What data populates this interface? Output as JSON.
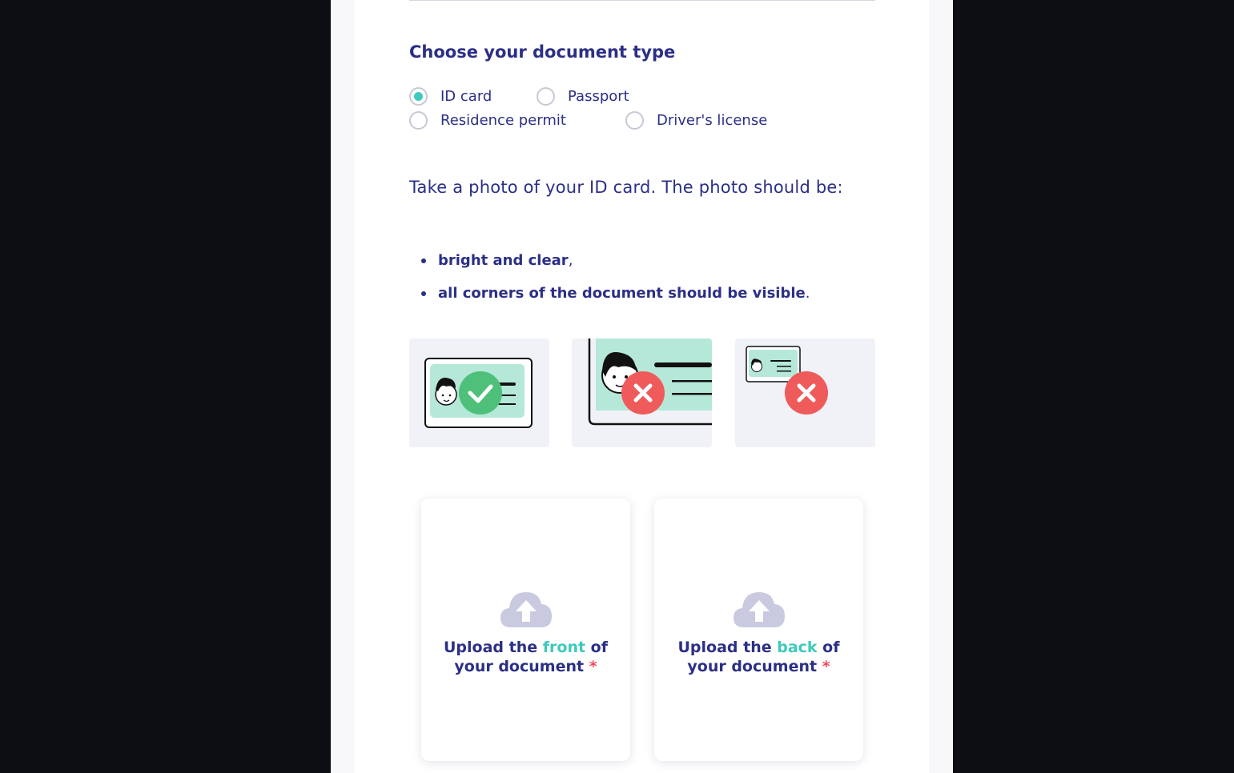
{
  "form": {
    "heading": "Choose your document type",
    "document_types": [
      {
        "label": "ID card",
        "checked": true
      },
      {
        "label": "Passport",
        "checked": false
      },
      {
        "label": "Residence permit",
        "checked": false
      },
      {
        "label": "Driver's license",
        "checked": false
      }
    ],
    "instructions": {
      "intro": "Take a photo of your ID card. The photo should be:",
      "bullets": [
        {
          "strong": "bright and clear",
          "suffix": ","
        },
        {
          "strong": "all corners of the document should be visible",
          "suffix": "."
        }
      ]
    },
    "examples": [
      {
        "name": "correct-photo",
        "status": "check-icon"
      },
      {
        "name": "too-close-photo",
        "status": "cross-icon"
      },
      {
        "name": "too-far-photo",
        "status": "cross-icon"
      }
    ],
    "upload_front": {
      "prefix": "Upload the ",
      "accent": "front",
      "rest1": " of",
      "rest2": "your document",
      "required": "*"
    },
    "upload_back": {
      "prefix": "Upload the ",
      "accent": "back",
      "rest1": " of",
      "rest2": "your document",
      "required": "*"
    }
  },
  "colors": {
    "primary_text": "#2b2f86",
    "accent": "#3ecabc",
    "required": "#f04b5a",
    "card_mint": "#b5e8d9",
    "ok_green": "#4ec07a",
    "error_red": "#ef5b5b",
    "cloud": "#c9cae0"
  }
}
